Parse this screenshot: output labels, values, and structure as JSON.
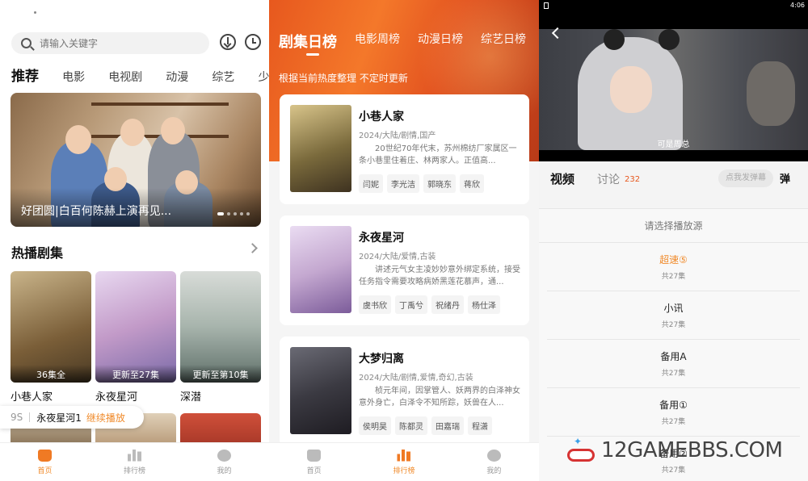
{
  "home": {
    "search_placeholder": "请输入关键字",
    "categories": [
      "推荐",
      "电影",
      "电视剧",
      "动漫",
      "综艺",
      "少儿"
    ],
    "banner_title": "好团圆|白百何陈赫上演再见...",
    "section_title": "热播剧集",
    "posters": [
      {
        "title": "小巷人家",
        "badge": "36集全",
        "color": "#8a6b3f"
      },
      {
        "title": "永夜星河",
        "badge": "更新至27集",
        "color": "#c7a3c8"
      },
      {
        "title": "深潜",
        "badge": "更新至第10集",
        "color": "#9fb0a8"
      }
    ],
    "continue": {
      "episode": "9S",
      "name": "永夜星河1",
      "action": "继续播放"
    },
    "tabs": [
      "首页",
      "排行榜",
      "我的"
    ]
  },
  "rank": {
    "tabs": [
      "剧集日榜",
      "电影周榜",
      "动漫日榜",
      "综艺日榜"
    ],
    "note": "根据当前热度整理 不定时更新",
    "items": [
      {
        "title": "小巷人家",
        "meta": "2024/大陆/剧情,国产",
        "desc": "20世纪70年代末，苏州棉纺厂家属区一条小巷里住着庄、林两家人。正值高...",
        "tags": [
          "闫妮",
          "李光洁",
          "郭晓东",
          "蒋欣"
        ],
        "color": "#7a6a3c"
      },
      {
        "title": "永夜星河",
        "meta": "2024/大陆/爱情,古装",
        "desc": "讲述元气女主凌妙妙意外绑定系统，接受任务指令需要攻略病娇黑莲花慕声，通...",
        "tags": [
          "虞书欣",
          "丁禹兮",
          "祝绪丹",
          "杨仕泽"
        ],
        "color": "#c4a8d0"
      },
      {
        "title": "大梦归离",
        "meta": "2024/大陆/剧情,爱情,奇幻,古装",
        "desc": "桢元年间，因掌管人、妖两界的白泽神女意外身亡，白泽令不知所踪，妖兽在人...",
        "tags": [
          "侯明昊",
          "陈都灵",
          "田嘉瑞",
          "程潇"
        ],
        "color": "#3b3a42"
      }
    ],
    "tabbar": [
      "首页",
      "排行榜",
      "我的"
    ]
  },
  "player": {
    "time": "4:06",
    "subtitle": "可是周总",
    "tab_video": "视频",
    "tab_comment": "讨论",
    "comment_count": "232",
    "danmu_placeholder": "点我发弹幕",
    "danmu_button": "弹",
    "source_header": "请选择播放源",
    "sources": [
      {
        "name": "超速⑤",
        "episodes": "共27集",
        "selected": true
      },
      {
        "name": "小讯",
        "episodes": "共27集",
        "selected": false
      },
      {
        "name": "备用A",
        "episodes": "共27集",
        "selected": false
      },
      {
        "name": "备用①",
        "episodes": "共27集",
        "selected": false
      },
      {
        "name": "备用②",
        "episodes": "共27集",
        "selected": false
      }
    ]
  },
  "watermark": "12GAMEBBS.COM",
  "colors": {
    "accent": "#f08a2a",
    "rank_header": "#e7581e"
  }
}
